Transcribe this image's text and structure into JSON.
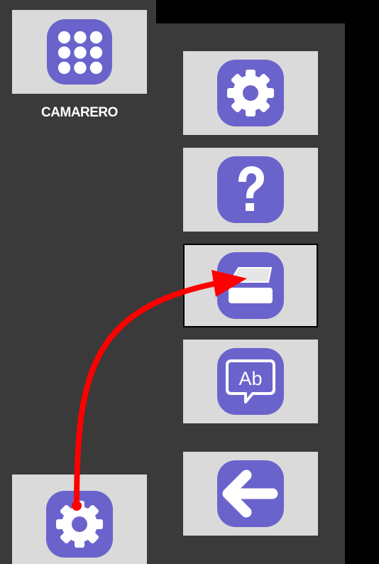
{
  "colors": {
    "panel_bg": "#3a3a3a",
    "tile_bg": "#dadada",
    "icon_purple": "#6b63cc",
    "annotation_arrow": "#ff0000",
    "label_text": "#ffffff"
  },
  "user_tile": {
    "icon": "grid-menu-icon",
    "label": "CAMARERO"
  },
  "right_menu": [
    {
      "icon": "settings-gear-icon",
      "selected": false
    },
    {
      "icon": "help-question-icon",
      "selected": false
    },
    {
      "icon": "scanner-icon",
      "selected": true
    },
    {
      "icon": "language-speech-bubble-icon",
      "label": "Ab",
      "selected": false
    },
    {
      "icon": "back-arrow-icon",
      "selected": false
    }
  ],
  "bottom_tile": {
    "icon": "settings-gear-icon"
  },
  "annotation": {
    "type": "curved-arrow",
    "from": "bottom-settings-button",
    "to": "scanner-button"
  }
}
